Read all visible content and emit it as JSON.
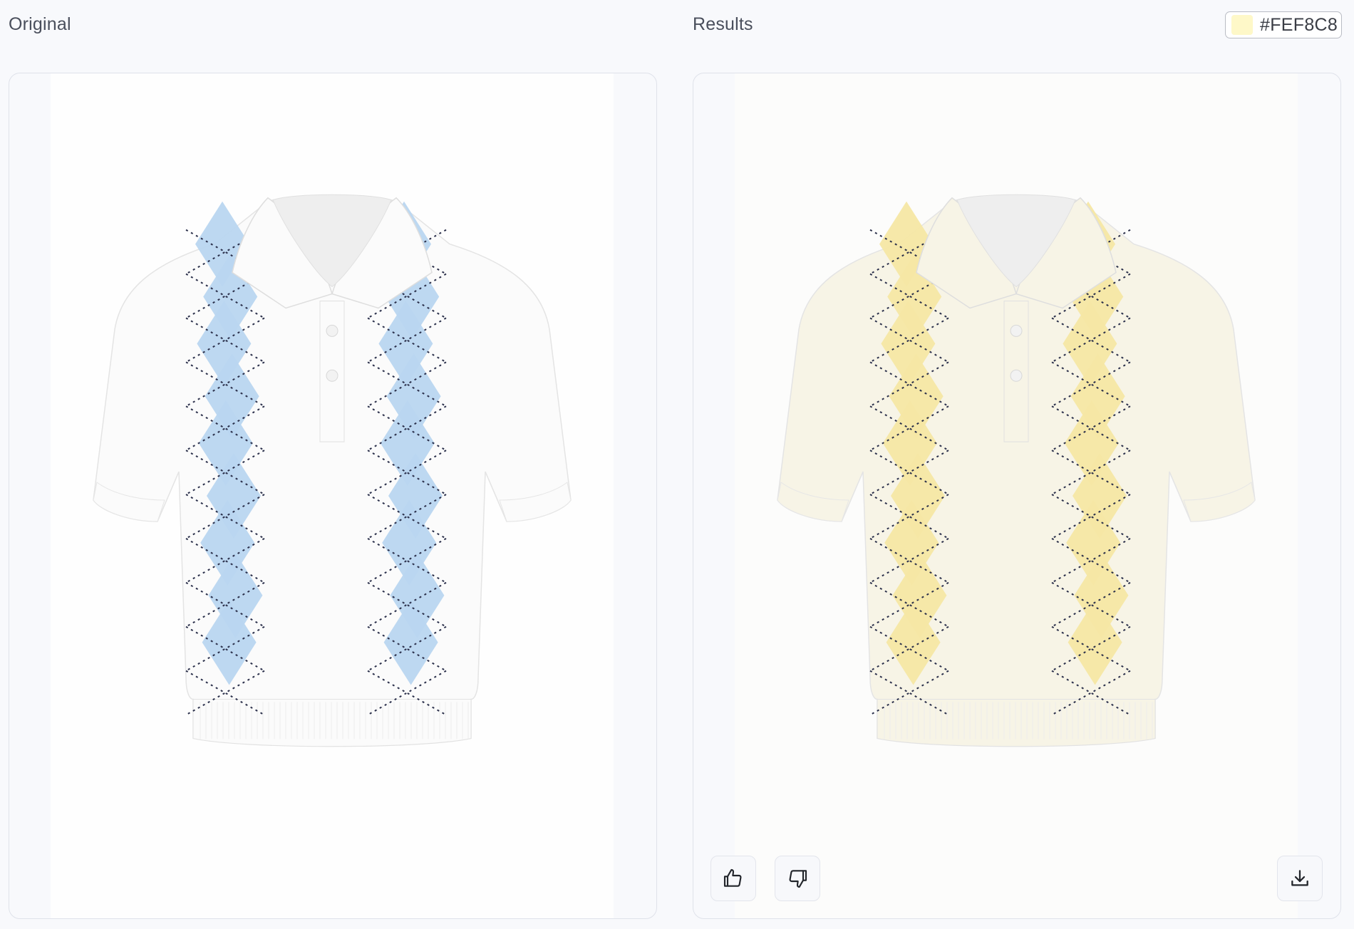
{
  "labels": {
    "original": "Original",
    "results": "Results"
  },
  "color_chip": {
    "hex_text": "#FEF8C8",
    "swatch_color": "#FEF8C8"
  },
  "original_image": {
    "description_icon": "garment-photo",
    "garment_color": "#fbfbfb",
    "argyle_color": "#b9d6f0"
  },
  "result_image": {
    "description_icon": "garment-photo",
    "garment_color": "#f7f4e6",
    "argyle_color": "#f6e7a4"
  },
  "actions": {
    "like_icon": "thumbs-up-icon",
    "dislike_icon": "thumbs-down-icon",
    "download_icon": "download-icon"
  }
}
